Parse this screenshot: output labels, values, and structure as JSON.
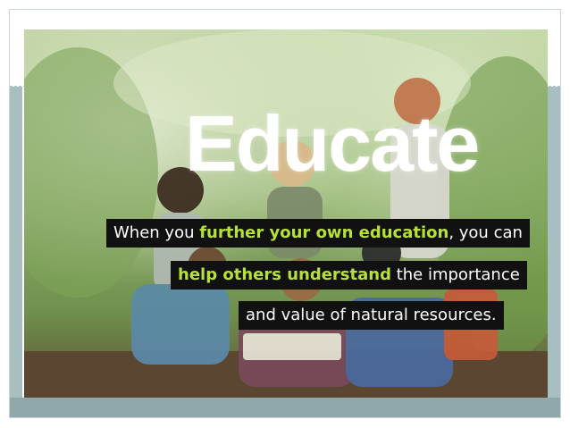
{
  "slide": {
    "headline": "Educate",
    "caption": {
      "line1": {
        "pre": "When you ",
        "highlight": "further your own education",
        "post": ", you can"
      },
      "line2": {
        "pre": "",
        "highlight": "help others understand",
        "post": " the importance"
      },
      "line3": {
        "pre": "and value of natural resources.",
        "highlight": "",
        "post": ""
      }
    }
  },
  "colors": {
    "highlight": "#b8e03a",
    "caption_bg": "#111111",
    "band": "#8fa9ab"
  }
}
